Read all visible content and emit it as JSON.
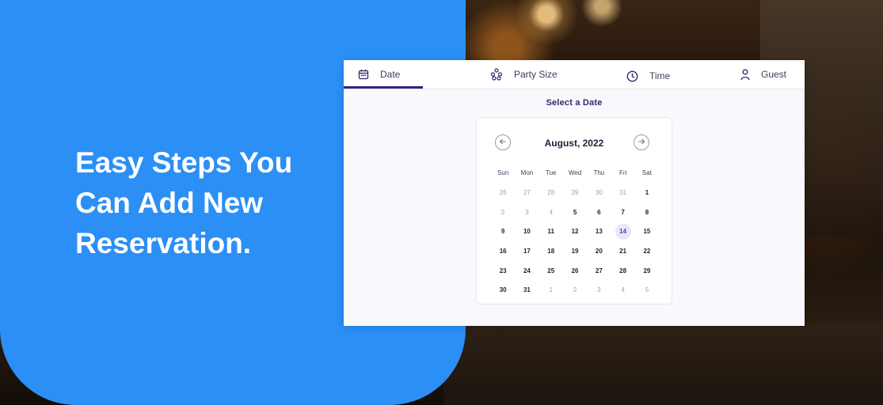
{
  "headline": "Easy Steps You Can Add New Reservation.",
  "tabs": [
    {
      "label": "Date",
      "icon": "calendar-icon"
    },
    {
      "label": "Party Size",
      "icon": "people-icon"
    },
    {
      "label": "Time",
      "icon": "clock-icon"
    },
    {
      "label": "Guest",
      "icon": "user-icon"
    }
  ],
  "colors": {
    "accent": "#2b2680",
    "panel_blue": "#2b8ff5"
  },
  "section_title": "Select a Date",
  "calendar": {
    "month": "August, 2022",
    "prev_icon": "arrow-left-icon",
    "next_icon": "arrow-right-icon",
    "weekdays": [
      "Sun",
      "Mon",
      "Tue",
      "Wed",
      "Thu",
      "Fri",
      "Sat"
    ],
    "weeks": [
      [
        "26",
        "27",
        "28",
        "29",
        "30",
        "31",
        "1"
      ],
      [
        "2",
        "3",
        "4",
        "5",
        "6",
        "7",
        "8"
      ],
      [
        "9",
        "10",
        "11",
        "12",
        "13",
        "14",
        "15"
      ],
      [
        "16",
        "17",
        "18",
        "19",
        "20",
        "21",
        "22"
      ],
      [
        "23",
        "24",
        "25",
        "26",
        "27",
        "28",
        "29"
      ],
      [
        "30",
        "31",
        "1",
        "2",
        "3",
        "4",
        "5"
      ]
    ],
    "selected": "14"
  }
}
